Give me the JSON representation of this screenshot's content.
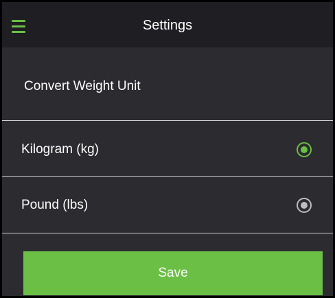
{
  "appbar": {
    "menu_icon": "hamburger-menu-icon",
    "title": "Settings"
  },
  "section": {
    "title": "Convert Weight Unit"
  },
  "options": [
    {
      "label": "Kilogram (kg)",
      "selected": true
    },
    {
      "label": "Pound (lbs)",
      "selected": false
    }
  ],
  "save": {
    "label": "Save"
  },
  "colors": {
    "accent": "#6bbf45",
    "background": "#2b2b30",
    "appbar": "#1f1f23",
    "text": "#ffffff",
    "divider": "#cfcfcf",
    "radio_unselected": "#bdbdbd"
  }
}
